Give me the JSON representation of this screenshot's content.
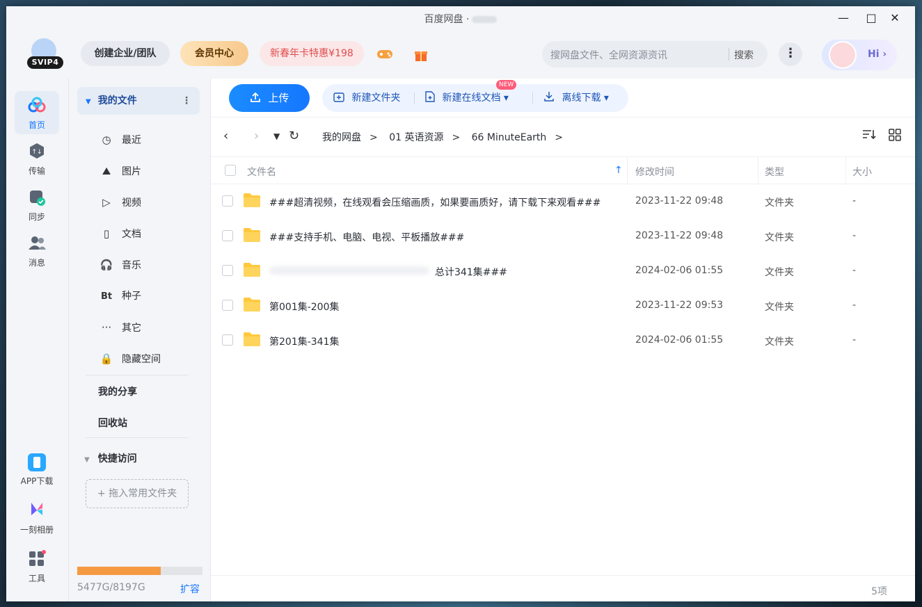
{
  "window": {
    "title": "百度网盘 ·",
    "minimize": "—",
    "maximize": "□",
    "close": "✕"
  },
  "header": {
    "logo_badge": "SVIP4",
    "enterprise": "创建企业/团队",
    "vip_center": "会员中心",
    "promo": "新春年卡特惠¥198",
    "search_placeholder": "搜网盘文件、全网资源资讯",
    "search_button": "搜索",
    "more": "⋮",
    "hi": "Hi ›"
  },
  "rail": {
    "items": [
      {
        "label": "首页"
      },
      {
        "label": "传输"
      },
      {
        "label": "同步"
      },
      {
        "label": "消息"
      }
    ],
    "bottom": [
      {
        "label": "APP下载"
      },
      {
        "label": "一刻相册"
      },
      {
        "label": "工具"
      }
    ]
  },
  "sidenav": {
    "head": "我的文件",
    "items": [
      {
        "label": "最近",
        "icon": "◷"
      },
      {
        "label": "图片",
        "icon": "⛰"
      },
      {
        "label": "视频",
        "icon": "▷"
      },
      {
        "label": "文档",
        "icon": "▯"
      },
      {
        "label": "音乐",
        "icon": "🎧"
      },
      {
        "label": "种子",
        "icon": "Bt"
      },
      {
        "label": "其它",
        "icon": "···"
      },
      {
        "label": "隐藏空间",
        "icon": "🔒"
      }
    ],
    "share": "我的分享",
    "recycle": "回收站",
    "quick": "快捷访问",
    "drop_folder": "+ 拖入常用文件夹",
    "quota": "5477G/8197G",
    "quota_used_fraction": 0.668,
    "expand": "扩容"
  },
  "toolbar": {
    "upload": "上传",
    "new_folder": "新建文件夹",
    "new_doc": "新建在线文档",
    "new_badge": "NEW",
    "offline": "离线下载"
  },
  "path": {
    "crumbs": [
      "我的网盘",
      "01 英语资源",
      "66 MinuteEarth"
    ]
  },
  "table": {
    "headers": {
      "name": "文件名",
      "modified": "修改时间",
      "type": "类型",
      "size": "大小"
    },
    "rows": [
      {
        "name": "###超清视频，在线观看会压缩画质，如果要画质好，请下载下来观看###",
        "modified": "2023-11-22 09:48",
        "type": "文件夹",
        "size": "-"
      },
      {
        "name": "###支持手机、电脑、电视、平板播放###",
        "modified": "2023-11-22 09:48",
        "type": "文件夹",
        "size": "-"
      },
      {
        "name": "总计341集###",
        "modified": "2024-02-06 01:55",
        "type": "文件夹",
        "size": "-"
      },
      {
        "name": "第001集-200集",
        "modified": "2023-11-22 09:53",
        "type": "文件夹",
        "size": "-"
      },
      {
        "name": "第201集-341集",
        "modified": "2024-02-06 01:55",
        "type": "文件夹",
        "size": "-"
      }
    ]
  },
  "footer": {
    "count": "5项"
  },
  "colors": {
    "accent": "#1677ff",
    "quota": "#f59a42",
    "folder": "#ffc83d"
  }
}
